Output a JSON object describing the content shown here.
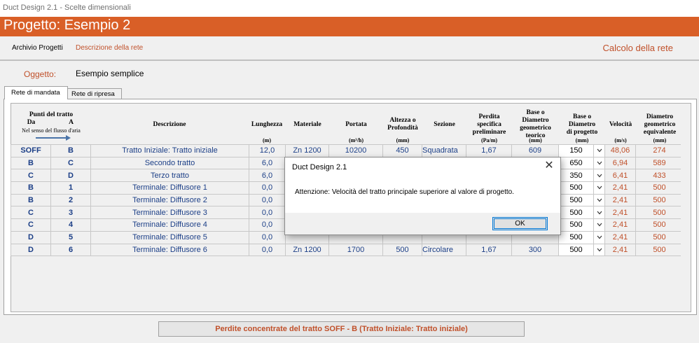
{
  "window": {
    "title": "Duct Design 2.1 - Scelte dimensionali"
  },
  "banner": {
    "title": "Progetto: Esempio 2"
  },
  "menu": {
    "archivio": "Archivio Progetti",
    "descrizione": "Descrizione della rete",
    "calcolo": "Calcolo della rete"
  },
  "oggetto": {
    "label": "Oggetto:",
    "value": "Esempio semplice"
  },
  "tabs": {
    "mandata": "Rete di mandata",
    "ripresa": "Rete di ripresa"
  },
  "headers": {
    "punti": "Punti del tratto",
    "da": "Da",
    "a": "A",
    "flusso": "Nel senso del flusso d'aria",
    "descrizione": "Descrizione",
    "lunghezza": "Lunghezza",
    "lunghezza_unit": "(m)",
    "materiale": "Materiale",
    "portata": "Portata",
    "portata_unit": "(m³/h)",
    "altezza_1": "Altezza o",
    "altezza_2": "Profondità",
    "altezza_unit": "(mm)",
    "sezione": "Sezione",
    "perdita_1": "Perdita",
    "perdita_2": "specifica",
    "perdita_3": "preliminare",
    "perdita_unit": "(Pa/m)",
    "base_teo_1": "Base o",
    "base_teo_2": "Diametro",
    "base_teo_3": "geometrico",
    "base_teo_4": "teorico",
    "base_teo_unit": "(mm)",
    "base_prog_1": "Base o",
    "base_prog_2": "Diametro",
    "base_prog_3": "di progetto",
    "base_prog_unit": "(mm)",
    "velocita": "Velocità",
    "velocita_unit": "(m/s)",
    "diam_eq_1": "Diametro",
    "diam_eq_2": "geometrico",
    "diam_eq_3": "equivalente",
    "diam_eq_unit": "(mm)"
  },
  "rows": [
    {
      "da": "SOFF",
      "a": "B",
      "descrizione": "Tratto Iniziale: Tratto iniziale",
      "lunghezza": "12,0",
      "materiale": "Zn 1200",
      "portata": "10200",
      "altezza": "450",
      "sezione": "Squadrata",
      "perdita": "1,67",
      "base_teorico": "609",
      "base_progetto": "150",
      "velocita": "48,06",
      "diam_eq": "274"
    },
    {
      "da": "B",
      "a": "C",
      "descrizione": "Secondo tratto",
      "lunghezza": "6,0",
      "materiale": "",
      "portata": "",
      "altezza": "",
      "sezione": "",
      "perdita": "",
      "base_teorico": "",
      "base_progetto": "650",
      "velocita": "6,94",
      "diam_eq": "589"
    },
    {
      "da": "C",
      "a": "D",
      "descrizione": "Terzo tratto",
      "lunghezza": "6,0",
      "materiale": "",
      "portata": "",
      "altezza": "",
      "sezione": "",
      "perdita": "",
      "base_teorico": "",
      "base_progetto": "350",
      "velocita": "6,41",
      "diam_eq": "433"
    },
    {
      "da": "B",
      "a": "1",
      "descrizione": "Terminale: Diffusore 1",
      "lunghezza": "0,0",
      "materiale": "",
      "portata": "",
      "altezza": "",
      "sezione": "",
      "perdita": "",
      "base_teorico": "",
      "base_progetto": "500",
      "velocita": "2,41",
      "diam_eq": "500"
    },
    {
      "da": "B",
      "a": "2",
      "descrizione": "Terminale: Diffusore 2",
      "lunghezza": "0,0",
      "materiale": "",
      "portata": "",
      "altezza": "",
      "sezione": "",
      "perdita": "",
      "base_teorico": "",
      "base_progetto": "500",
      "velocita": "2,41",
      "diam_eq": "500"
    },
    {
      "da": "C",
      "a": "3",
      "descrizione": "Terminale: Diffusore 3",
      "lunghezza": "0,0",
      "materiale": "",
      "portata": "",
      "altezza": "",
      "sezione": "",
      "perdita": "",
      "base_teorico": "",
      "base_progetto": "500",
      "velocita": "2,41",
      "diam_eq": "500"
    },
    {
      "da": "C",
      "a": "4",
      "descrizione": "Terminale: Diffusore 4",
      "lunghezza": "0,0",
      "materiale": "",
      "portata": "",
      "altezza": "",
      "sezione": "",
      "perdita": "",
      "base_teorico": "",
      "base_progetto": "500",
      "velocita": "2,41",
      "diam_eq": "500"
    },
    {
      "da": "D",
      "a": "5",
      "descrizione": "Terminale: Diffusore 5",
      "lunghezza": "0,0",
      "materiale": "",
      "portata": "",
      "altezza": "",
      "sezione": "",
      "perdita": "",
      "base_teorico": "",
      "base_progetto": "500",
      "velocita": "2,41",
      "diam_eq": "500"
    },
    {
      "da": "D",
      "a": "6",
      "descrizione": "Terminale: Diffusore 6",
      "lunghezza": "0,0",
      "materiale": "Zn 1200",
      "portata": "1700",
      "altezza": "500",
      "sezione": "Circolare",
      "perdita": "1,67",
      "base_teorico": "300",
      "base_progetto": "500",
      "velocita": "2,41",
      "diam_eq": "500"
    }
  ],
  "footer": {
    "button": "Perdite concentrate del tratto SOFF - B  (Tratto Iniziale: Tratto iniziale)"
  },
  "dialog": {
    "title": "Duct Design 2.1",
    "close": "✕",
    "message": "Attenzione: Velocità del tratto principale superiore al valore di progetto.",
    "ok": "OK"
  }
}
